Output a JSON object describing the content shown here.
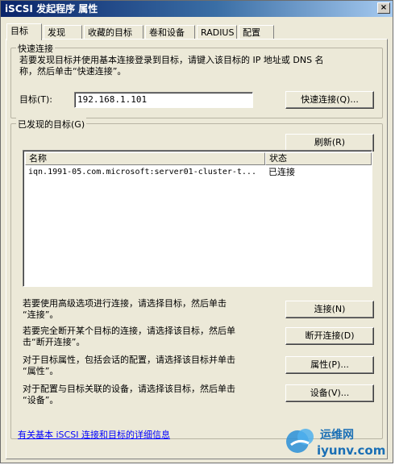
{
  "window": {
    "title": "iSCSI 发起程序 属性",
    "close_glyph": "×"
  },
  "tabs": [
    {
      "label": "目标"
    },
    {
      "label": "发现"
    },
    {
      "label": "收藏的目标"
    },
    {
      "label": "卷和设备"
    },
    {
      "label": "RADIUS"
    },
    {
      "label": "配置"
    }
  ],
  "quick_connect": {
    "group_label": "快速连接",
    "description": "若要发现目标并使用基本连接登录到目标，请键入该目标的 IP 地址或 DNS 名\n称，然后单击“快速连接”。",
    "target_label": "目标(T):",
    "target_value": "192.168.1.101",
    "button_label": "快速连接(Q)..."
  },
  "discovered": {
    "group_label": "已发现的目标(G)",
    "refresh_label": "刷新(R)",
    "columns": [
      "名称",
      "状态"
    ],
    "rows": [
      {
        "name": "iqn.1991-05.com.microsoft:server01-cluster-t...",
        "status": "已连接"
      }
    ]
  },
  "actions": [
    {
      "text": "若要使用高级选项进行连接，请选择目标，然后单击\n“连接”。",
      "button": "连接(N)"
    },
    {
      "text": "若要完全断开某个目标的连接，请选择该目标，然后单\n击“断开连接”。",
      "button": "断开连接(D)"
    },
    {
      "text": "对于目标属性，包括会话的配置，请选择该目标并单击\n“属性”。",
      "button": "属性(P)..."
    },
    {
      "text": "对于配置与目标关联的设备，请选择该目标，然后单击\n“设备”。",
      "button": "设备(V)..."
    }
  ],
  "footer_link": "有关基本 iSCSI 连接和目标的详细信息",
  "watermark": {
    "cn": "运维网",
    "en": "iyunv.com"
  }
}
